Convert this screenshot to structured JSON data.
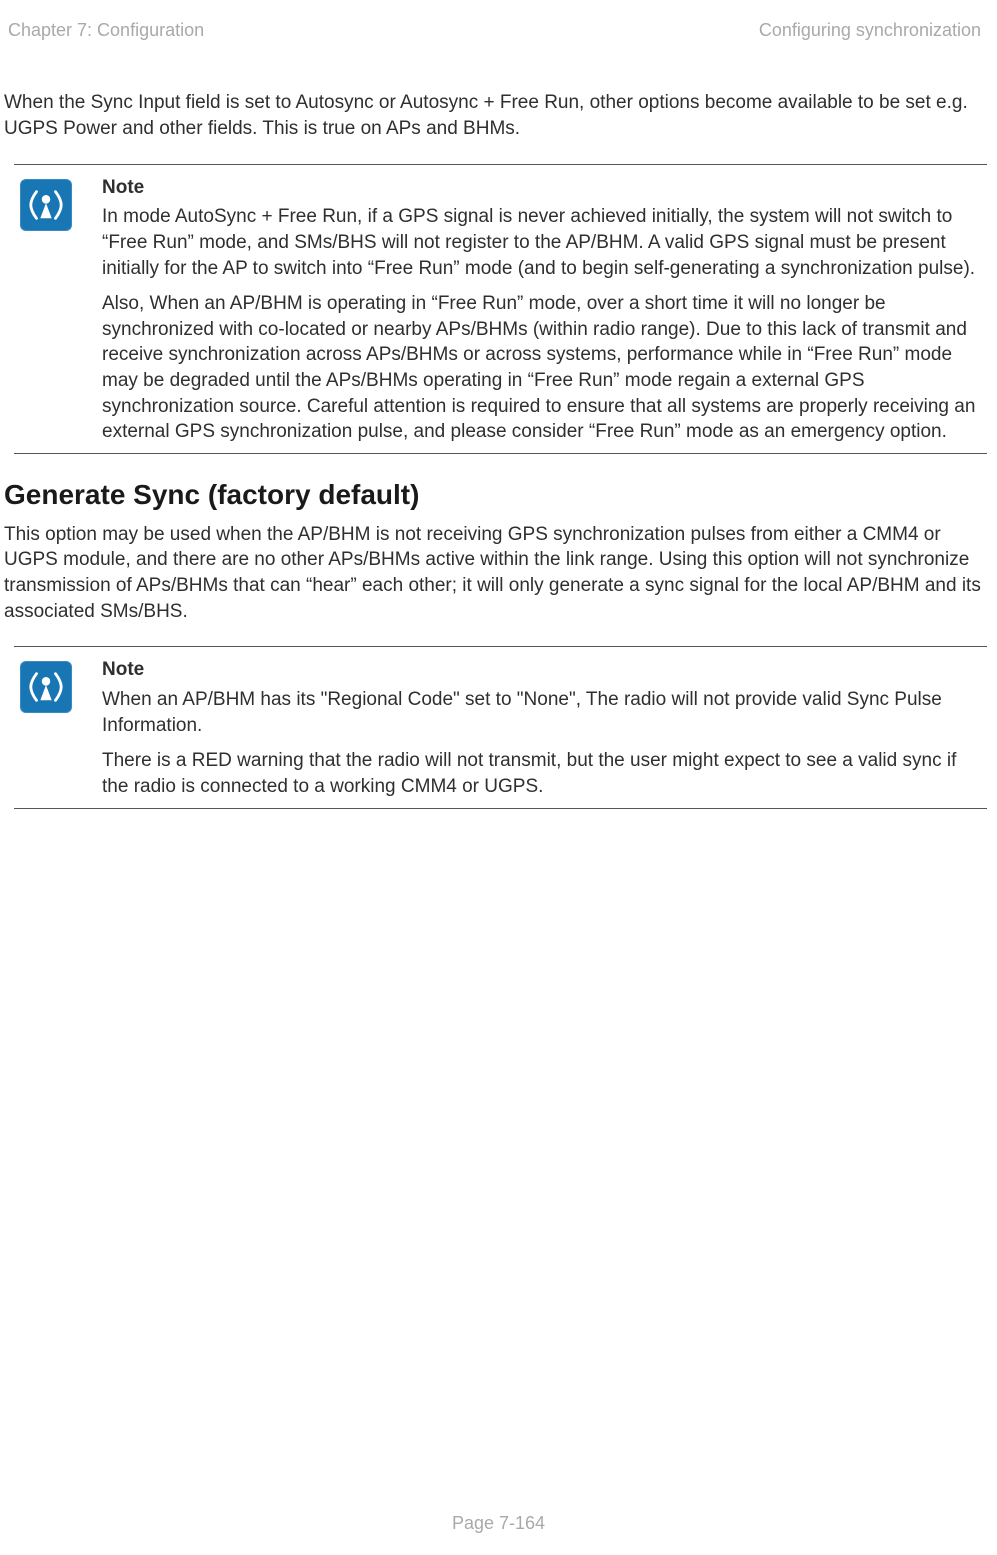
{
  "header": {
    "left": "Chapter 7:  Configuration",
    "right": "Configuring synchronization"
  },
  "intro": "When the Sync Input field is set to Autosync or Autosync + Free Run, other options become available to be set e.g. UGPS Power and other fields. This is true on APs and BHMs.",
  "note1": {
    "heading": "Note",
    "p1": "In mode AutoSync + Free Run, if a GPS signal is never achieved initially, the system will not switch to “Free Run” mode, and SMs/BHS will not register to the AP/BHM. A valid GPS signal must be present initially for the AP to switch into “Free Run” mode (and to begin self-generating a synchronization pulse).",
    "p2": "Also, When an AP/BHM is operating in “Free Run” mode, over a short time it will no longer be synchronized with co-located or nearby APs/BHMs (within radio range). Due to this lack of transmit and receive synchronization across APs/BHMs or across systems, performance while in “Free Run” mode may be degraded until the APs/BHMs operating in “Free Run” mode regain a external GPS synchronization source. Careful attention is required to ensure that all systems are properly receiving an external GPS synchronization pulse, and please consider “Free Run” mode as an emergency option."
  },
  "section_heading": "Generate Sync (factory default)",
  "section_body": "This option may be used when the AP/BHM is not receiving GPS synchronization pulses from either a CMM4 or UGPS module, and there are no other APs/BHMs active within the link range. Using this option will not synchronize transmission of APs/BHMs that can “hear” each other; it will only generate a sync signal for the local AP/BHM and its associated SMs/BHS.",
  "note2": {
    "heading": "Note",
    "p1": "When an AP/BHM has its \"Regional Code\" set to \"None\", The radio will not provide valid Sync Pulse Information.",
    "p2": "There is a RED warning that the radio will not transmit, but the user might expect to see a valid sync if the radio is connected to a working CMM4 or UGPS."
  },
  "footer": "Page 7-164"
}
